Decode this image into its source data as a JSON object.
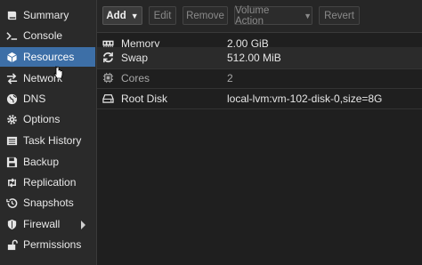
{
  "sidebar": {
    "items": [
      {
        "label": "Summary",
        "icon": "book-icon"
      },
      {
        "label": "Console",
        "icon": "terminal-icon"
      },
      {
        "label": "Resources",
        "icon": "cube-icon",
        "active": true
      },
      {
        "label": "Network",
        "icon": "exchange-icon"
      },
      {
        "label": "DNS",
        "icon": "globe-icon"
      },
      {
        "label": "Options",
        "icon": "gear-icon"
      },
      {
        "label": "Task History",
        "icon": "list-icon"
      },
      {
        "label": "Backup",
        "icon": "floppy-icon"
      },
      {
        "label": "Replication",
        "icon": "retweet-icon"
      },
      {
        "label": "Snapshots",
        "icon": "history-icon"
      },
      {
        "label": "Firewall",
        "icon": "shield-icon"
      },
      {
        "label": "Permissions",
        "icon": "unlock-icon"
      }
    ]
  },
  "toolbar": {
    "add_label": "Add",
    "edit_label": "Edit",
    "remove_label": "Remove",
    "volume_action_label": "Volume Action",
    "revert_label": "Revert"
  },
  "grid": {
    "rows": [
      {
        "key": "Memory",
        "value": "2.00 GiB",
        "icon": "memory-icon"
      },
      {
        "key": "Swap",
        "value": "512.00 MiB",
        "icon": "refresh-icon"
      },
      {
        "key": "Cores",
        "value": "2",
        "icon": "cpu-icon"
      },
      {
        "key": "Root Disk",
        "value": "local-lvm:vm-102-disk-0,size=8G",
        "icon": "hdd-icon"
      }
    ]
  },
  "colors": {
    "accent": "#3d6fa7",
    "background": "#1f1f1f",
    "sidebar": "#2a2a2a"
  }
}
